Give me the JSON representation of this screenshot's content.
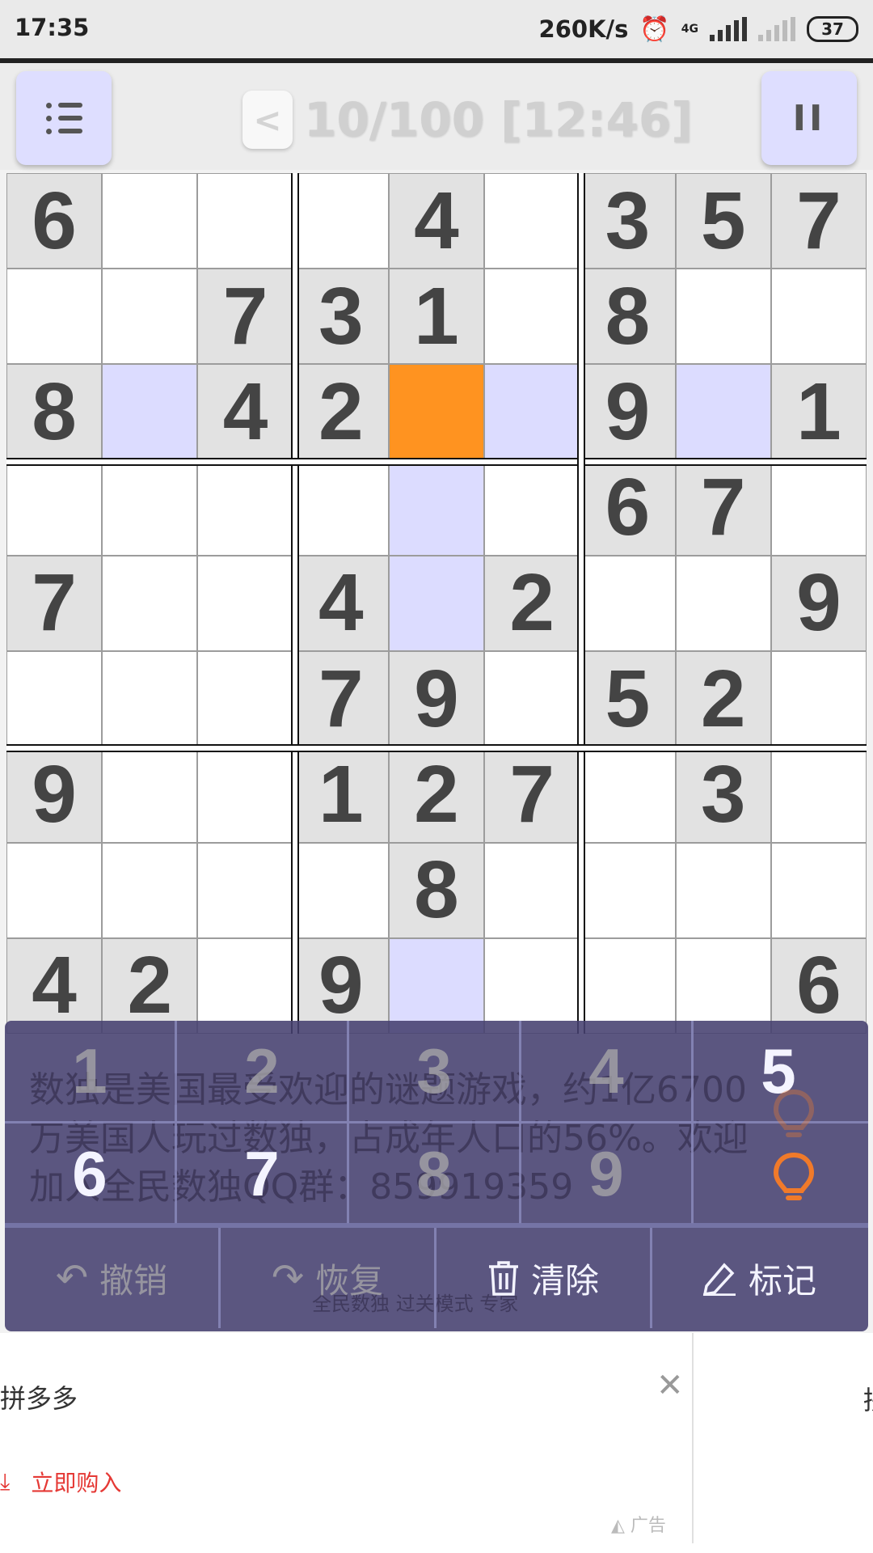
{
  "status_bar": {
    "time": "17:35",
    "speed": "260K/s",
    "network": "4G",
    "battery": "37",
    "icons": [
      "alarm-icon",
      "signal-icon",
      "signal-weak-icon",
      "battery-icon"
    ]
  },
  "header": {
    "menu_icon": "list-icon",
    "back_label": "<",
    "progress": "10/100 [12:46]",
    "pause_label": "II"
  },
  "board": {
    "rows": [
      [
        6,
        0,
        0,
        0,
        4,
        0,
        3,
        5,
        7
      ],
      [
        0,
        0,
        7,
        3,
        1,
        0,
        8,
        0,
        0
      ],
      [
        8,
        0,
        4,
        2,
        0,
        0,
        9,
        0,
        1
      ],
      [
        0,
        0,
        0,
        0,
        0,
        0,
        6,
        7,
        0
      ],
      [
        7,
        0,
        0,
        4,
        0,
        2,
        0,
        0,
        9
      ],
      [
        0,
        0,
        0,
        7,
        9,
        0,
        5,
        2,
        0
      ],
      [
        9,
        0,
        0,
        1,
        2,
        7,
        0,
        3,
        0
      ],
      [
        0,
        0,
        0,
        0,
        8,
        0,
        0,
        0,
        0
      ],
      [
        4,
        2,
        0,
        9,
        0,
        0,
        0,
        0,
        6
      ]
    ],
    "selected": {
      "row": 2,
      "col": 4
    },
    "colors": {
      "given": "#e2e2e2",
      "empty": "#ffffff",
      "highlight": "#dcdcff",
      "selected": "#ff9320",
      "digit": "#444444"
    }
  },
  "ad_overlay": {
    "text": "数独是美国最受欢迎的谜题游戏，约1亿6700万美国人玩过数独，占成年人口的56%。欢迎加入全民数独QQ群：859919359",
    "sub": "全民数独 过关模式 专家"
  },
  "keypad": {
    "keys": [
      {
        "label": "1",
        "state": "used"
      },
      {
        "label": "2",
        "state": "used"
      },
      {
        "label": "3",
        "state": "used"
      },
      {
        "label": "4",
        "state": "used"
      },
      {
        "label": "5",
        "state": "free"
      },
      {
        "label": "6",
        "state": "free"
      },
      {
        "label": "7",
        "state": "free"
      },
      {
        "label": "8",
        "state": "used"
      },
      {
        "label": "9",
        "state": "used"
      }
    ],
    "hint_icon": "lightbulb-icon",
    "hint_color": "#f07a2a"
  },
  "actions": [
    {
      "label": "撤销",
      "icon": "undo-icon",
      "enabled": false
    },
    {
      "label": "恢复",
      "icon": "redo-icon",
      "enabled": false
    },
    {
      "label": "清除",
      "icon": "trash-icon",
      "enabled": true
    },
    {
      "label": "标记",
      "icon": "pencil-icon",
      "enabled": true
    }
  ],
  "bottom_ad": {
    "brand": "拼多多",
    "buy_label": "立即购入",
    "ad_label": "广告",
    "edge_text": "拼",
    "close_icon": "close-icon",
    "download_icon": "download-icon"
  }
}
